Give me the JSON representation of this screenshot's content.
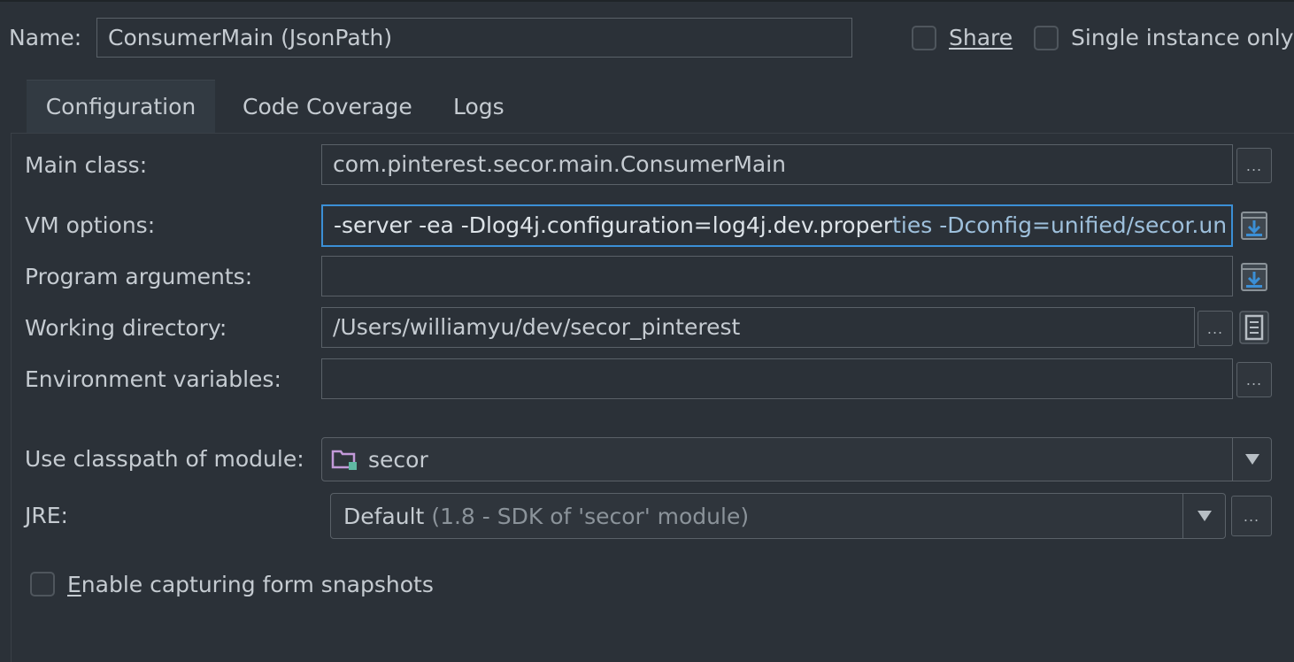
{
  "name": {
    "label": "Name:",
    "value": "ConsumerMain (JsonPath)"
  },
  "share": {
    "label": "Share"
  },
  "single_instance": {
    "label": "Single instance only"
  },
  "tabs": [
    {
      "label": "Configuration",
      "active": true
    },
    {
      "label": "Code Coverage",
      "active": false
    },
    {
      "label": "Logs",
      "active": false
    }
  ],
  "main_class": {
    "label": "Main class:",
    "value": "com.pinterest.secor.main.ConsumerMain"
  },
  "vm_options": {
    "label": "VM options:",
    "value_main": "-server -ea -Dlog4j.configuration=log4j.dev.proper",
    "value_rest": "ties -Dconfig=unified/secor.un"
  },
  "program_arguments": {
    "label": "Program arguments:",
    "value": ""
  },
  "working_directory": {
    "label": "Working directory:",
    "value": "/Users/williamyu/dev/secor_pinterest"
  },
  "environment_variables": {
    "label": "Environment variables:",
    "value": ""
  },
  "classpath_module": {
    "label": "Use classpath of module:",
    "value": "secor"
  },
  "jre": {
    "label": "JRE:",
    "value": "Default",
    "detail": "(1.8 - SDK of 'secor' module)"
  },
  "capture_snapshots": {
    "label": "Enable capturing form snapshots"
  },
  "browse_label": "...",
  "icons": {
    "browse": "ellipsis-icon",
    "expand": "expand-field-icon",
    "macro": "document-icon",
    "dropdown": "triangle-down-icon",
    "module": "module-folder-icon"
  },
  "colors": {
    "background": "#2b3138",
    "focus_border": "#3b8fd6",
    "text": "#c5cbd1",
    "muted": "#8b939a"
  }
}
